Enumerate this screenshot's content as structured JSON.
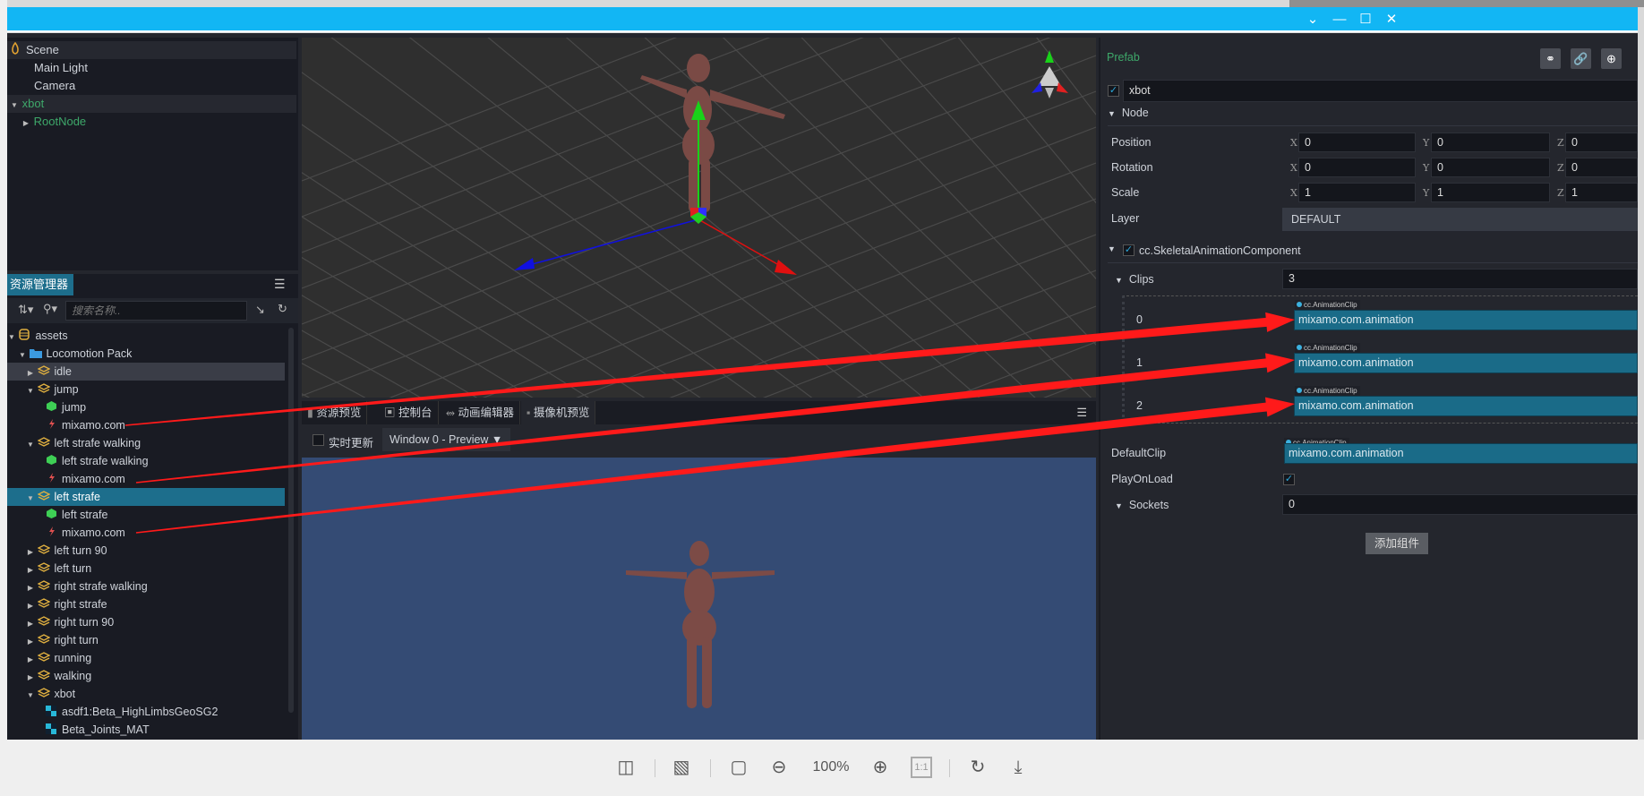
{
  "window": {
    "controls": [
      "chevron-down",
      "minimize",
      "maximize",
      "close"
    ]
  },
  "hierarchy": {
    "items": [
      {
        "label": "Scene",
        "level": 0,
        "icon": "scene",
        "color": "#cfd3da",
        "hl": true
      },
      {
        "label": "Main Light",
        "level": 1,
        "color": "#cfd3da"
      },
      {
        "label": "Camera",
        "level": 1,
        "color": "#cfd3da"
      },
      {
        "label": "xbot",
        "level": 0,
        "arrow": "down",
        "color": "#3ea86a",
        "hl": true
      },
      {
        "label": "RootNode",
        "level": 1,
        "arrow": "right",
        "color": "#3ea86a"
      }
    ]
  },
  "assets": {
    "tab_label": "资源管理器",
    "search_placeholder": "搜索名称..",
    "items": [
      {
        "label": "assets",
        "level": 0,
        "icon": "db",
        "arrow": "down"
      },
      {
        "label": "Locomotion Pack",
        "level": 1,
        "icon": "folder",
        "arrow": "down"
      },
      {
        "label": "idle",
        "level": 2,
        "icon": "prefab",
        "arrow": "right",
        "state": "hl"
      },
      {
        "label": "jump",
        "level": 2,
        "icon": "prefab",
        "arrow": "down"
      },
      {
        "label": "jump",
        "level": 3,
        "icon": "mesh"
      },
      {
        "label": "mixamo.com",
        "level": 3,
        "icon": "anim"
      },
      {
        "label": "left strafe walking",
        "level": 2,
        "icon": "prefab",
        "arrow": "down"
      },
      {
        "label": "left strafe walking",
        "level": 3,
        "icon": "mesh"
      },
      {
        "label": "mixamo.com",
        "level": 3,
        "icon": "anim"
      },
      {
        "label": "left strafe",
        "level": 2,
        "icon": "prefab",
        "arrow": "down",
        "state": "sel"
      },
      {
        "label": "left strafe",
        "level": 3,
        "icon": "mesh"
      },
      {
        "label": "mixamo.com",
        "level": 3,
        "icon": "anim"
      },
      {
        "label": "left turn 90",
        "level": 2,
        "icon": "prefab",
        "arrow": "right"
      },
      {
        "label": "left turn",
        "level": 2,
        "icon": "prefab",
        "arrow": "right"
      },
      {
        "label": "right strafe walking",
        "level": 2,
        "icon": "prefab",
        "arrow": "right"
      },
      {
        "label": "right strafe",
        "level": 2,
        "icon": "prefab",
        "arrow": "right"
      },
      {
        "label": "right turn 90",
        "level": 2,
        "icon": "prefab",
        "arrow": "right"
      },
      {
        "label": "right turn",
        "level": 2,
        "icon": "prefab",
        "arrow": "right"
      },
      {
        "label": "running",
        "level": 2,
        "icon": "prefab",
        "arrow": "right"
      },
      {
        "label": "walking",
        "level": 2,
        "icon": "prefab",
        "arrow": "right"
      },
      {
        "label": "xbot",
        "level": 2,
        "icon": "prefab",
        "arrow": "down"
      },
      {
        "label": "asdf1:Beta_HighLimbsGeoSG2",
        "level": 3,
        "icon": "material"
      },
      {
        "label": "Beta_Joints_MAT",
        "level": 3,
        "icon": "material"
      }
    ]
  },
  "bottom_panel": {
    "tabs": [
      "资源预览",
      "控制台",
      "动画编辑器",
      "摄像机预览"
    ],
    "realtime_label": "实时更新",
    "realtime_checked": false,
    "window_select": "Window 0 - Preview ▼"
  },
  "inspector": {
    "prefab_label": "Prefab",
    "node_name": "xbot",
    "node_enabled": true,
    "node_section": "Node",
    "position": {
      "label": "Position",
      "x": "0",
      "y": "0",
      "z": "0"
    },
    "rotation": {
      "label": "Rotation",
      "x": "0",
      "y": "0",
      "z": "0"
    },
    "scale": {
      "label": "Scale",
      "x": "1",
      "y": "1",
      "z": "1"
    },
    "axis_labels": {
      "x": "X",
      "y": "Y",
      "z": "Z"
    },
    "layer": {
      "label": "Layer",
      "value": "DEFAULT"
    },
    "component": {
      "name": "cc.SkeletalAnimationComponent",
      "enabled": true
    },
    "clips": {
      "label": "Clips",
      "count": "3",
      "type_tag": "cc.AnimationClip",
      "items": [
        {
          "index": "0",
          "value": "mixamo.com.animation"
        },
        {
          "index": "1",
          "value": "mixamo.com.animation"
        },
        {
          "index": "2",
          "value": "mixamo.com.animation"
        }
      ]
    },
    "default_clip": {
      "label": "DefaultClip",
      "value": "mixamo.com.animation"
    },
    "play_on_load": {
      "label": "PlayOnLoad",
      "checked": true
    },
    "sockets": {
      "label": "Sockets",
      "value": "0"
    },
    "add_component": "添加组件"
  },
  "viewer": {
    "zoom": "100%",
    "ratio": "1:1"
  },
  "colors": {
    "titlebar": "#12b6f4",
    "selection": "#1d6e8c",
    "annotation": "#ff1a1a"
  }
}
